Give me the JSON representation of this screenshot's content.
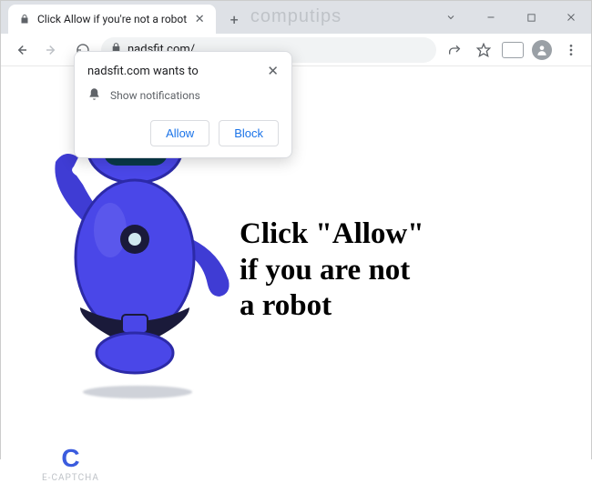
{
  "window": {
    "watermark": "computips"
  },
  "tab": {
    "title": "Click Allow if you're not a robot"
  },
  "addressbar": {
    "url": "nadsfit.com/"
  },
  "permission": {
    "wants_to": "nadsfit.com wants to",
    "action_label": "Show notifications",
    "allow": "Allow",
    "block": "Block"
  },
  "page": {
    "headline_line1": "Click \"Allow\"",
    "headline_line2": "if you are not",
    "headline_line3": "a robot",
    "captcha_label": "E-CAPTCHA"
  }
}
